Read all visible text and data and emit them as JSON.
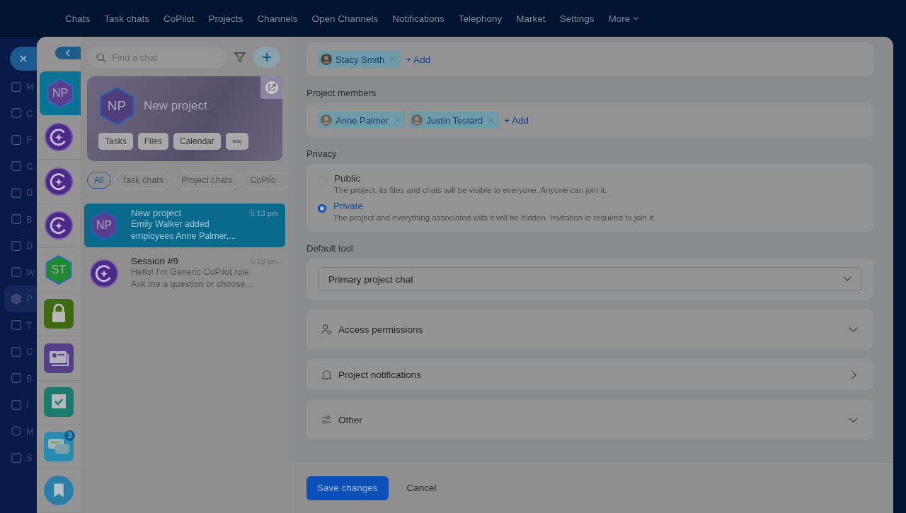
{
  "top_nav": {
    "items": [
      {
        "label": "Chats",
        "caret": false
      },
      {
        "label": "Task chats",
        "caret": false
      },
      {
        "label": "CoPilot",
        "caret": false
      },
      {
        "label": "Projects",
        "caret": false
      },
      {
        "label": "Channels",
        "caret": false
      },
      {
        "label": "Open Channels",
        "caret": false
      },
      {
        "label": "Notifications",
        "caret": false
      },
      {
        "label": "Telephony",
        "caret": false
      },
      {
        "label": "Market",
        "caret": false
      },
      {
        "label": "Settings",
        "caret": false
      },
      {
        "label": "More",
        "caret": true
      }
    ]
  },
  "left_nav": {
    "items": [
      {
        "label": "M",
        "kind": "chat",
        "selected": false
      },
      {
        "label": "C",
        "kind": "star",
        "selected": false
      },
      {
        "label": "F",
        "kind": "doc",
        "selected": false
      },
      {
        "label": "C",
        "kind": "calendar",
        "selected": false
      },
      {
        "label": "D",
        "kind": "doc",
        "selected": false
      },
      {
        "label": "B",
        "kind": "board",
        "selected": false
      },
      {
        "label": "D",
        "kind": "card",
        "selected": false
      },
      {
        "label": "W",
        "kind": "mail",
        "selected": false
      },
      {
        "label": "P",
        "kind": "hex",
        "selected": true
      },
      {
        "label": "T",
        "kind": "check",
        "selected": false
      },
      {
        "label": "C",
        "kind": "filter",
        "selected": false
      },
      {
        "label": "B",
        "kind": "calendar",
        "selected": false
      },
      {
        "label": "I",
        "kind": "card",
        "selected": false
      },
      {
        "label": "M",
        "kind": "target",
        "selected": false
      },
      {
        "label": "S",
        "kind": "cart",
        "selected": false
      }
    ]
  },
  "recent_chats": [
    {
      "kind": "initials",
      "text": "NP",
      "color": "#5b3f8f",
      "selected": true
    },
    {
      "kind": "copilot",
      "selected": false
    },
    {
      "kind": "copilot",
      "selected": false
    },
    {
      "kind": "copilot",
      "selected": false
    },
    {
      "kind": "initials",
      "text": "ST",
      "color": "#1f8a2e",
      "selected": false
    },
    {
      "kind": "lock",
      "selected": false
    },
    {
      "kind": "contacts",
      "selected": false
    },
    {
      "kind": "checklist",
      "selected": false
    },
    {
      "kind": "messages",
      "badge": "3",
      "selected": false
    },
    {
      "kind": "bookmark",
      "selected": false
    }
  ],
  "chat_panel": {
    "search": {
      "placeholder": "Find a chat"
    },
    "project_card": {
      "initials": "NP",
      "title": "New project",
      "buttons": [
        "Tasks",
        "Files",
        "Calendar"
      ]
    },
    "filters": [
      {
        "label": "All",
        "selected": true
      },
      {
        "label": "Task chats",
        "selected": false
      },
      {
        "label": "Project chats",
        "selected": false
      },
      {
        "label": "CoPilo",
        "selected": false
      }
    ],
    "chats": [
      {
        "kind": "project",
        "initials": "NP",
        "title": "New project",
        "time": "5:13 pm",
        "preview_lines": [
          "Emily Walker added",
          "employees Anne Palmer,..."
        ],
        "selected": true
      },
      {
        "kind": "copilot",
        "title": "Session #9",
        "time": "5:13 pm",
        "preview_lines": [
          "Hello! I'm Generic CoPilot role.",
          "Ask me a question or choose..."
        ],
        "selected": false
      }
    ]
  },
  "form": {
    "owners": {
      "chips": [
        "Stacy Smith"
      ],
      "add": "+ Add"
    },
    "members": {
      "label": "Project members",
      "chips": [
        "Anne Palmer",
        "Justin Testard"
      ],
      "add": "+ Add"
    },
    "privacy": {
      "label": "Privacy",
      "options": [
        {
          "title": "Public",
          "description": "The project, its files and chats will be visible to everyone. Anyone can join it.",
          "selected": false
        },
        {
          "title": "Private",
          "description": "The project and everything associated with it will be hidden. Invitation is required to join it.",
          "selected": true
        }
      ]
    },
    "default_tool": {
      "label": "Default tool",
      "value": "Primary project chat"
    },
    "sections": [
      {
        "title": "Access permissions",
        "kind": "collapsible"
      },
      {
        "title": "Project notifications",
        "kind": "link"
      },
      {
        "title": "Other",
        "kind": "collapsible"
      }
    ]
  },
  "footer": {
    "save": "Save changes",
    "cancel": "Cancel"
  }
}
